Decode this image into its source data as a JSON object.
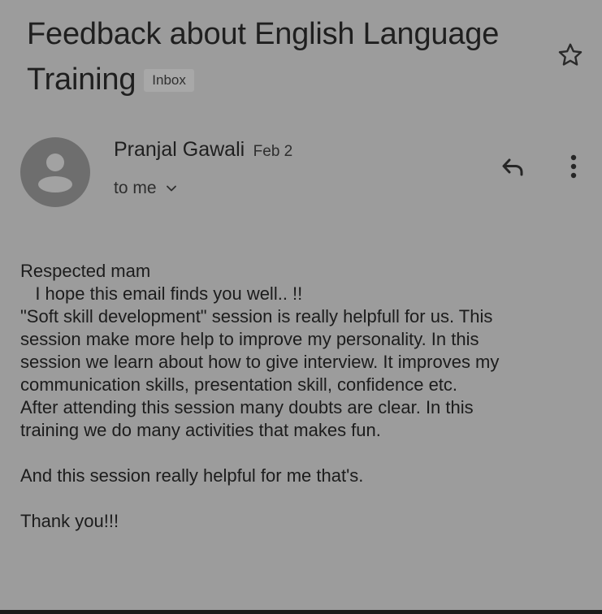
{
  "email": {
    "subject": "Feedback about English Language Training",
    "label_badge": "Inbox",
    "sender": {
      "name": "Pranjal Gawali",
      "date": "Feb 2",
      "recipient": "to me"
    },
    "body_lines": [
      "Respected mam",
      "   I hope this email finds you well.. !!",
      "\"Soft skill development\" session is really helpfull for us. This",
      "session make more help to improve my personality. In this",
      "session we learn about how to give interview. It improves my",
      "communication skills, presentation skill, confidence etc.",
      "After attending this session many doubts are clear. In this",
      "training we do many activities that makes fun.",
      "",
      "And this session really helpful for me that's.",
      "",
      "Thank you!!!"
    ]
  },
  "icons": {
    "star": "star-outline-icon",
    "avatar": "person-avatar-icon",
    "reply": "reply-arrow-icon",
    "more": "more-vertical-icon",
    "expand": "chevron-down-icon"
  },
  "colors": {
    "background": "#9c9c9c",
    "text": "#1c1c1c",
    "badge_bg": "#a8a8a8",
    "avatar_bg": "#6e6e6e",
    "avatar_fg": "#a2a2a2"
  }
}
